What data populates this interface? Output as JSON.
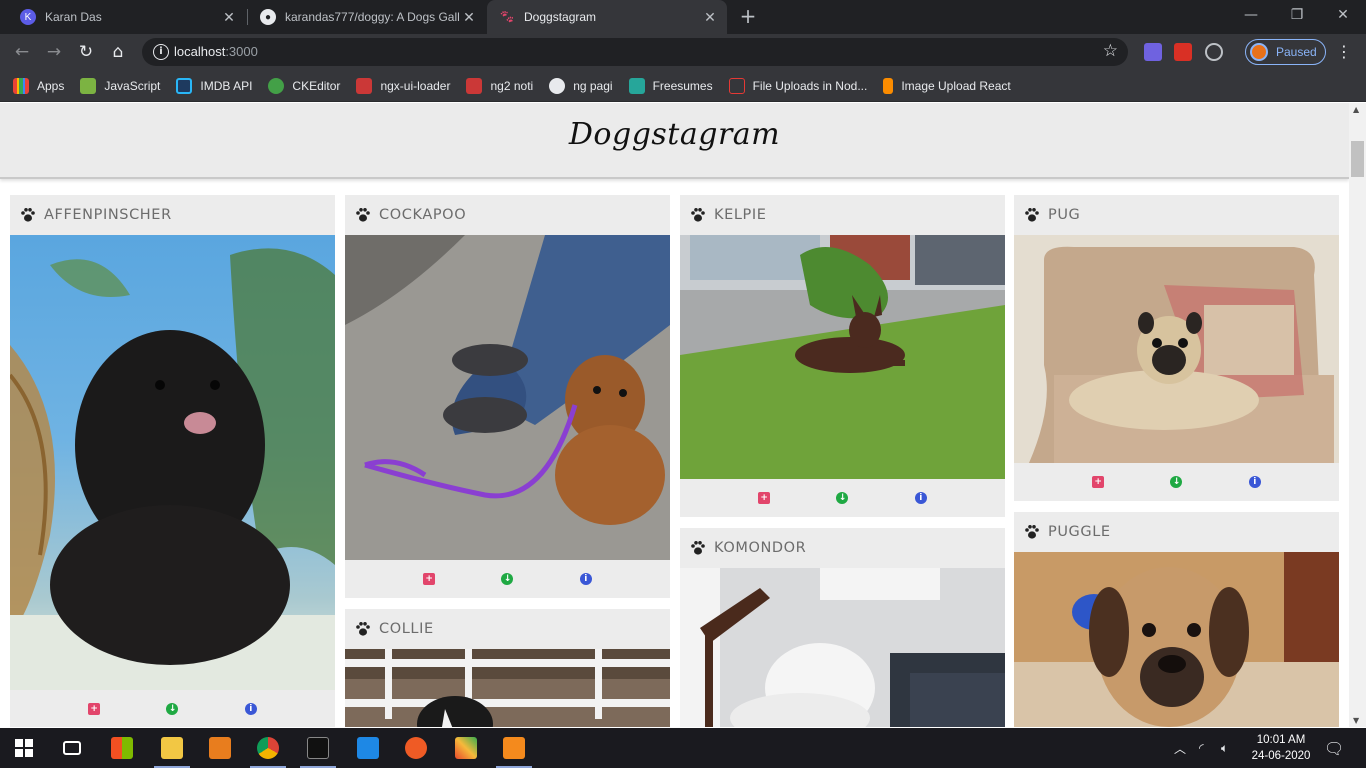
{
  "browser": {
    "tabs": [
      {
        "title": "Karan Das",
        "favicon": "k-circle-icon",
        "active": false
      },
      {
        "title": "karandas777/doggy: A Dogs Gall",
        "favicon": "github-icon",
        "active": false
      },
      {
        "title": "Doggstagram",
        "favicon": "paw-icon",
        "active": true
      }
    ],
    "url_host": "localhost",
    "url_port": ":3000",
    "profile_status": "Paused",
    "bookmarks": [
      {
        "label": "Apps",
        "icon": "apps-grid-icon",
        "color": "#f4b400"
      },
      {
        "label": "JavaScript",
        "icon": "javascript-icon",
        "color": "#7cb342"
      },
      {
        "label": "IMDB API",
        "icon": "imdb-icon",
        "color": "#1e88e5"
      },
      {
        "label": "CKEditor",
        "icon": "ckeditor-icon",
        "color": "#43a047"
      },
      {
        "label": "ngx-ui-loader",
        "icon": "npm-icon",
        "color": "#cb3837"
      },
      {
        "label": "ng2 noti",
        "icon": "npm-icon",
        "color": "#cb3837"
      },
      {
        "label": "ng pagi",
        "icon": "globe-icon",
        "color": "#e8eaed"
      },
      {
        "label": "Freesumes",
        "icon": "freesumes-icon",
        "color": "#26a69a"
      },
      {
        "label": "File Uploads in Nod...",
        "icon": "sa-icon",
        "color": "#e53935"
      },
      {
        "label": "Image Upload React",
        "icon": "bookmark-icon",
        "color": "#fb8c00"
      }
    ]
  },
  "page": {
    "title": "Doggstagram",
    "accent_add": "#e2456b",
    "accent_download": "#1fa943",
    "accent_info": "#3a57d6"
  },
  "dogs": [
    {
      "breed": "AFFENPINSCHER"
    },
    {
      "breed": "COCKAPOO"
    },
    {
      "breed": "COLLIE"
    },
    {
      "breed": "KELPIE"
    },
    {
      "breed": "KOMONDOR"
    },
    {
      "breed": "PUG"
    },
    {
      "breed": "PUGGLE"
    }
  ],
  "taskbar": {
    "time": "10:01 AM",
    "date": "24-06-2020"
  }
}
